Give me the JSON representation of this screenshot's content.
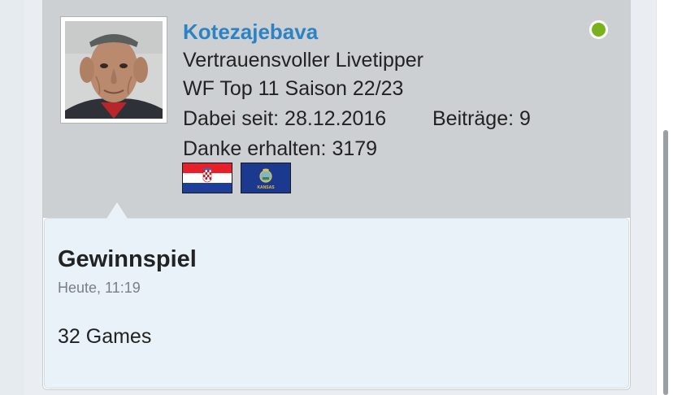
{
  "profile": {
    "username": "Kotezajebava",
    "rank": "Vertrauensvoller Livetipper",
    "award": "WF Top 11 Saison 22/23",
    "joined": "Dabei seit: 28.12.2016",
    "posts": "Beiträge: 9",
    "thanks": "Danke erhalten: 3179",
    "status": "online",
    "status_color": "#7bb21c",
    "avatar_alt": "avatar",
    "flags": [
      {
        "icon": "croatia-flag"
      },
      {
        "icon": "kansas-flag",
        "text": "KANSAS"
      }
    ]
  },
  "post": {
    "title": "Gewinnspiel",
    "time": "Heute, 11:19",
    "body": "32 Games"
  },
  "colors": {
    "accent": "#2d82c3",
    "panel": "#cdd0d3",
    "post_bg": "#e9f2f8"
  }
}
